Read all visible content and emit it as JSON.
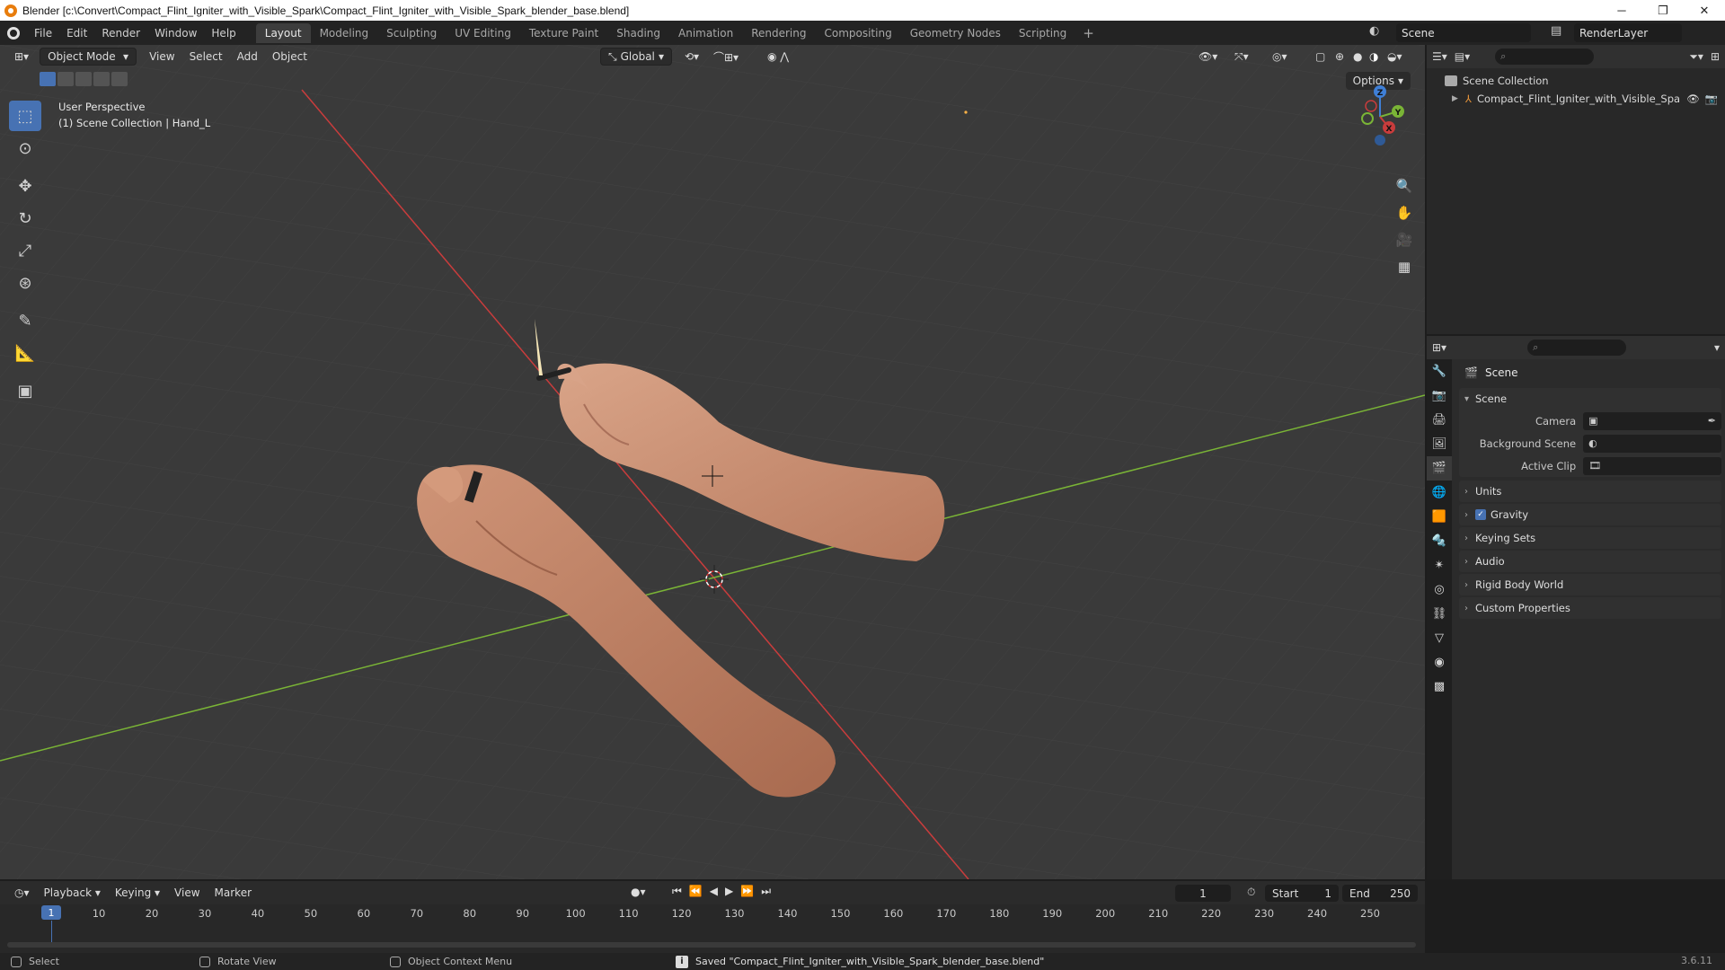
{
  "window": {
    "title": "Blender [c:\\Convert\\Compact_Flint_Igniter_with_Visible_Spark\\Compact_Flint_Igniter_with_Visible_Spark_blender_base.blend]",
    "minimize": "─",
    "maximize": "❐",
    "close": "✕"
  },
  "menu": [
    "File",
    "Edit",
    "Render",
    "Window",
    "Help"
  ],
  "workspaces": [
    "Layout",
    "Modeling",
    "Sculpting",
    "UV Editing",
    "Texture Paint",
    "Shading",
    "Animation",
    "Rendering",
    "Compositing",
    "Geometry Nodes",
    "Scripting"
  ],
  "workspace_add": "+",
  "scene_name": "Scene",
  "view_layer": "RenderLayer",
  "viewport": {
    "mode": "Object Mode",
    "menus": [
      "View",
      "Select",
      "Add",
      "Object"
    ],
    "orientation": "Global",
    "options": "Options",
    "perspective": "User Perspective",
    "collection_info": "(1) Scene Collection | Hand_L",
    "gizmo": {
      "x": "X",
      "y": "Y",
      "z": "Z"
    }
  },
  "outliner": {
    "root": "Scene Collection",
    "items": [
      {
        "name": "Compact_Flint_Igniter_with_Visible_Spa"
      }
    ]
  },
  "properties": {
    "context": "Scene",
    "panel_scene": "Scene",
    "rows": [
      {
        "label": "Camera",
        "value": ""
      },
      {
        "label": "Background Scene",
        "value": ""
      },
      {
        "label": "Active Clip",
        "value": ""
      }
    ],
    "sub_panels": [
      "Units",
      "Gravity",
      "Keying Sets",
      "Audio",
      "Rigid Body World",
      "Custom Properties"
    ]
  },
  "timeline": {
    "menus": [
      "Playback",
      "Keying",
      "View",
      "Marker"
    ],
    "current_frame": "1",
    "start_label": "Start",
    "start": "1",
    "end_label": "End",
    "end": "250",
    "ticks": [
      "1",
      "10",
      "20",
      "30",
      "40",
      "50",
      "60",
      "70",
      "80",
      "90",
      "100",
      "110",
      "120",
      "130",
      "140",
      "150",
      "160",
      "170",
      "180",
      "190",
      "200",
      "210",
      "220",
      "230",
      "240",
      "250"
    ]
  },
  "status": {
    "select": "Select",
    "rotate": "Rotate View",
    "context_menu": "Object Context Menu",
    "message": "Saved \"Compact_Flint_Igniter_with_Visible_Spark_blender_base.blend\"",
    "version": "3.6.11"
  },
  "colors": {
    "accent": "#4772b3",
    "x_axis": "#c93c3c",
    "y_axis": "#7ab436",
    "z_axis": "#3f7fd6",
    "skin": "#c98a6b"
  }
}
